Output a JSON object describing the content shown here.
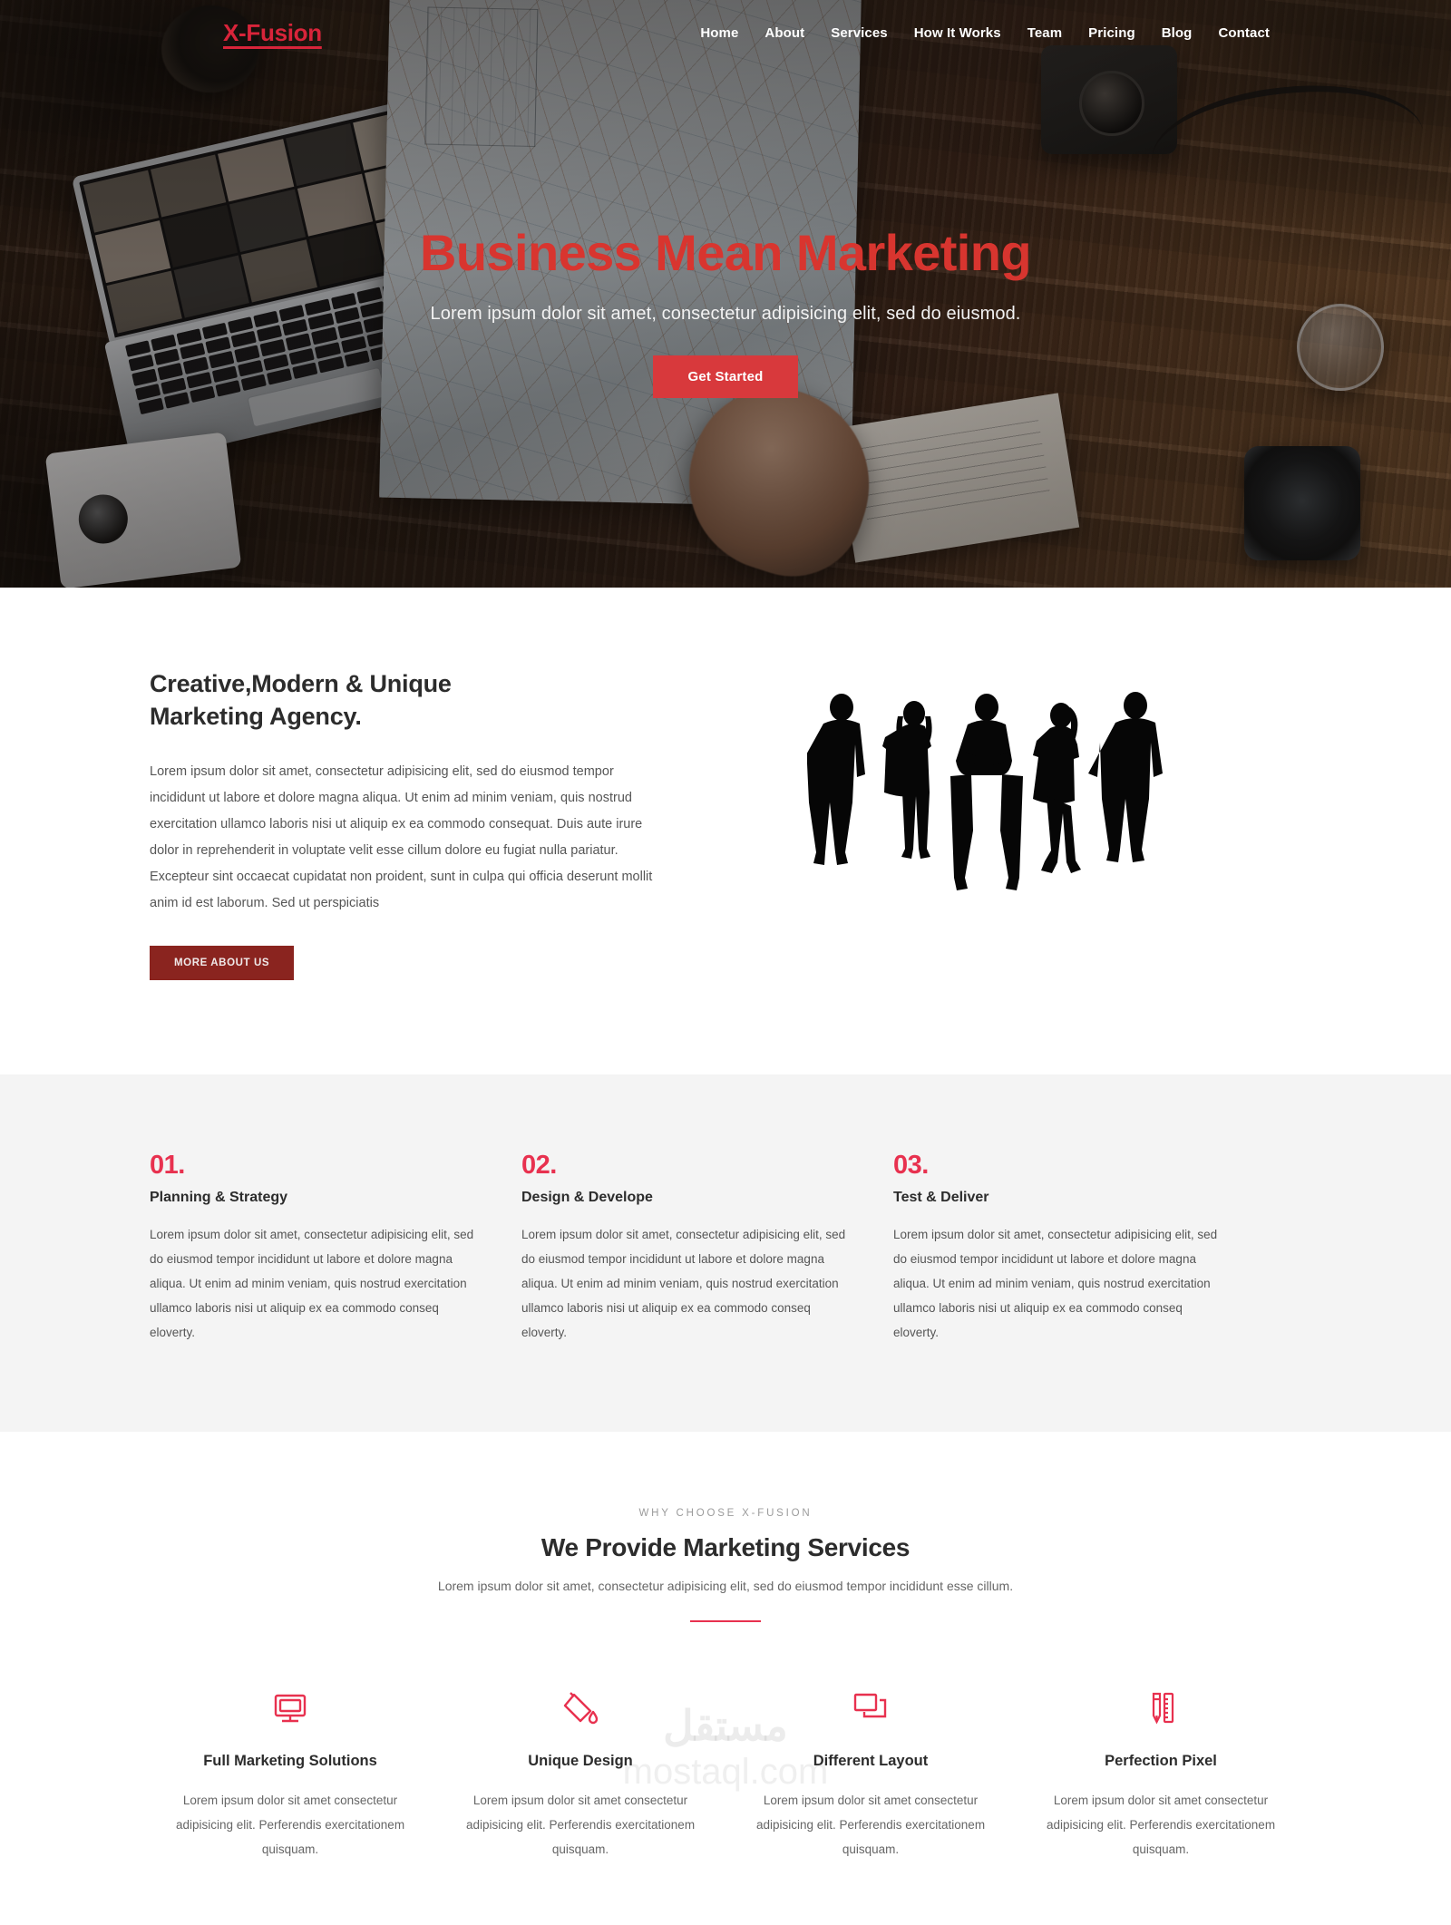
{
  "brand": {
    "name": "X-Fusion",
    "accent_red": "#d8243a",
    "accent_pink": "#e8314f",
    "accent_dark_red": "#8a241f"
  },
  "nav": {
    "logo": "X-Fusion",
    "links": [
      {
        "label": "Home"
      },
      {
        "label": "About"
      },
      {
        "label": "Services"
      },
      {
        "label": "How It Works"
      },
      {
        "label": "Team"
      },
      {
        "label": "Pricing"
      },
      {
        "label": "Blog"
      },
      {
        "label": "Contact"
      }
    ]
  },
  "hero": {
    "title": "Business Mean Marketing",
    "subtitle": "Lorem ipsum dolor sit amet, consectetur adipisicing elit, sed do eiusmod.",
    "cta": "Get Started"
  },
  "about": {
    "heading_line1": "Creative,Modern & Unique",
    "heading_line2": "Marketing Agency.",
    "paragraph": "Lorem ipsum dolor sit amet, consectetur adipisicing elit, sed do eiusmod tempor incididunt ut labore et dolore magna aliqua. Ut enim ad minim veniam, quis nostrud exercitation ullamco laboris nisi ut aliquip ex ea commodo consequat. Duis aute irure dolor in reprehenderit in voluptate velit esse cillum dolore eu fugiat nulla pariatur. Excepteur sint occaecat cupidatat non proident, sunt in culpa qui officia deserunt mollit anim id est laborum. Sed ut perspiciatis",
    "cta": "MORE ABOUT US",
    "image_alt": "business-team-silhouettes"
  },
  "steps": [
    {
      "number": "01.",
      "title": "Planning & Strategy",
      "text": "Lorem ipsum dolor sit amet, consectetur adipisicing elit, sed do eiusmod tempor incididunt ut labore et dolore magna aliqua. Ut enim ad minim veniam, quis nostrud exercitation ullamco laboris nisi ut aliquip ex ea commodo conseq eloverty."
    },
    {
      "number": "02.",
      "title": "Design & Develope",
      "text": "Lorem ipsum dolor sit amet, consectetur adipisicing elit, sed do eiusmod tempor incididunt ut labore et dolore magna aliqua. Ut enim ad minim veniam, quis nostrud exercitation ullamco laboris nisi ut aliquip ex ea commodo conseq eloverty."
    },
    {
      "number": "03.",
      "title": "Test & Deliver",
      "text": "Lorem ipsum dolor sit amet, consectetur adipisicing elit, sed do eiusmod tempor incididunt ut labore et dolore magna aliqua. Ut enim ad minim veniam, quis nostrud exercitation ullamco laboris nisi ut aliquip ex ea commodo conseq eloverty."
    }
  ],
  "services": {
    "eyebrow": "WHY CHOOSE X-FUSION",
    "heading": "We Provide Marketing Services",
    "subtitle": "Lorem ipsum dolor sit amet, consectetur adipisicing elit, sed do eiusmod tempor incididunt esse cillum.",
    "items": [
      {
        "icon": "monitor-icon",
        "title": "Full Marketing Solutions",
        "text": "Lorem ipsum dolor sit amet consectetur adipisicing elit. Perferendis exercitationem quisquam."
      },
      {
        "icon": "paint-bucket-icon",
        "title": "Unique Design",
        "text": "Lorem ipsum dolor sit amet consectetur adipisicing elit. Perferendis exercitationem quisquam."
      },
      {
        "icon": "layers-icon",
        "title": "Different Layout",
        "text": "Lorem ipsum dolor sit amet consectetur adipisicing elit. Perferendis exercitationem quisquam."
      },
      {
        "icon": "pencil-ruler-icon",
        "title": "Perfection Pixel",
        "text": "Lorem ipsum dolor sit amet consectetur adipisicing elit. Perferendis exercitationem quisquam."
      }
    ]
  },
  "watermark": {
    "arabic": "مستقل",
    "latin": "mostaql.com"
  }
}
